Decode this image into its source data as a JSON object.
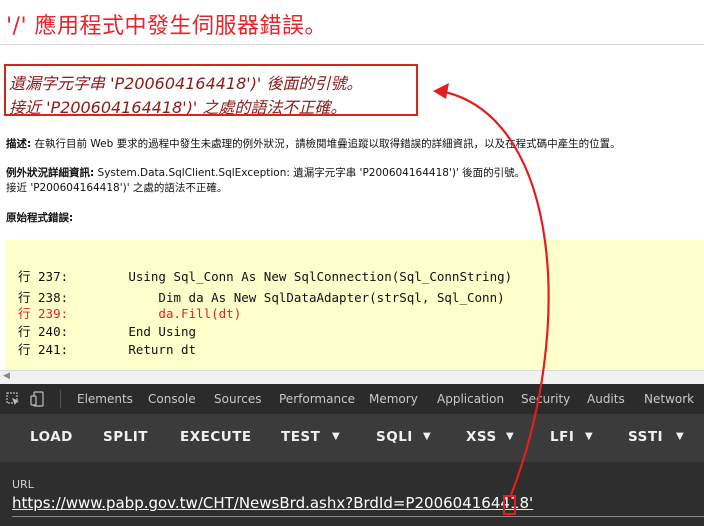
{
  "error_page": {
    "title": "'/' 應用程式中發生伺服器錯誤。",
    "message_line1": "遺漏字元字串 'P200604164418')' 後面的引號。",
    "message_line2": "接近 'P200604164418')' 之處的語法不正確。",
    "description_label": "描述:",
    "description_text": " 在執行目前 Web 要求的過程中發生未處理的例外狀況，請檢閱堆疊追蹤以取得錯誤的詳細資訊，以及在程式碼中產生的位置。",
    "exception_label": "例外狀況詳細資訊:",
    "exception_text": " System.Data.SqlClient.SqlException: 遺漏字元字串 'P200604164418')' 後面的引號。",
    "exception_line2": "接近 'P200604164418')' 之處的語法不正確。",
    "source_error_label": "原始程式錯誤:",
    "code_lines": [
      {
        "text": "行 237:        Using Sql_Conn As New SqlConnection(Sql_ConnString)"
      },
      {
        "text": "行 238:            Dim da As New SqlDataAdapter(strSql, Sql_Conn)"
      },
      {
        "text": "行 239:            da.Fill(dt)"
      },
      {
        "text": "行 240:        End Using"
      },
      {
        "text": "行 241:        Return dt"
      }
    ]
  },
  "devtools": {
    "tabs": [
      "Elements",
      "Console",
      "Sources",
      "Performance",
      "Memory",
      "Application",
      "Security",
      "Audits",
      "Network"
    ],
    "toolbar": {
      "load": "LOAD",
      "split": "SPLIT",
      "execute": "EXECUTE",
      "test": "TEST",
      "sqli": "SQLI",
      "xss": "XSS",
      "lfi": "LFI",
      "ssti": "SSTI"
    },
    "url_label": "URL",
    "url_value": "https://www.pabp.gov.tw/CHT/NewsBrd.ashx?BrdId=P200604164418'"
  },
  "colors": {
    "error_red": "#e8242b",
    "annotation_red": "#e02020",
    "code_bg": "#ffffcc",
    "devtools_bg": "#2b2b2b",
    "toolbar_bg": "#3b3b3b"
  }
}
